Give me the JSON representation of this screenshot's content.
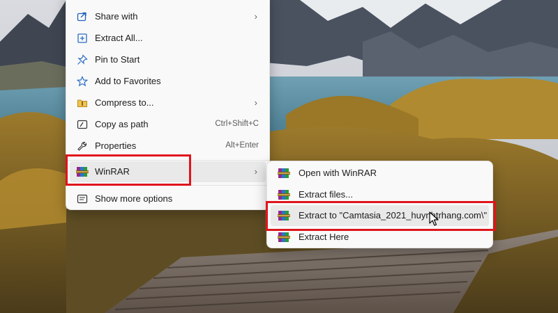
{
  "menu": {
    "items": [
      {
        "label": "Share with",
        "icon": "share-icon",
        "submenu": true
      },
      {
        "label": "Extract All...",
        "icon": "extract-all-icon"
      },
      {
        "label": "Pin to Start",
        "icon": "pin-icon"
      },
      {
        "label": "Add to Favorites",
        "icon": "star-icon"
      },
      {
        "label": "Compress to...",
        "icon": "zip-folder-icon",
        "submenu": true
      },
      {
        "label": "Copy as path",
        "icon": "copy-path-icon",
        "shortcut": "Ctrl+Shift+C"
      },
      {
        "label": "Properties",
        "icon": "wrench-icon",
        "shortcut": "Alt+Enter"
      },
      {
        "label": "WinRAR",
        "icon": "winrar-icon",
        "submenu": true,
        "highlighted": true
      },
      {
        "label": "Show more options",
        "icon": "show-more-icon"
      }
    ],
    "chevron": "›"
  },
  "submenu": {
    "items": [
      {
        "label": "Open with WinRAR",
        "icon": "winrar-icon"
      },
      {
        "label": "Extract files...",
        "icon": "winrar-icon"
      },
      {
        "label": "Extract to \"Camtasia_2021_huynhtrhang.com\\\"",
        "icon": "winrar-icon",
        "highlighted": true
      },
      {
        "label": "Extract Here",
        "icon": "winrar-icon"
      }
    ]
  },
  "colors": {
    "highlight": "#e0141c",
    "menu_bg": "#f9f9f9",
    "hover_bg": "#e9e9e9"
  }
}
